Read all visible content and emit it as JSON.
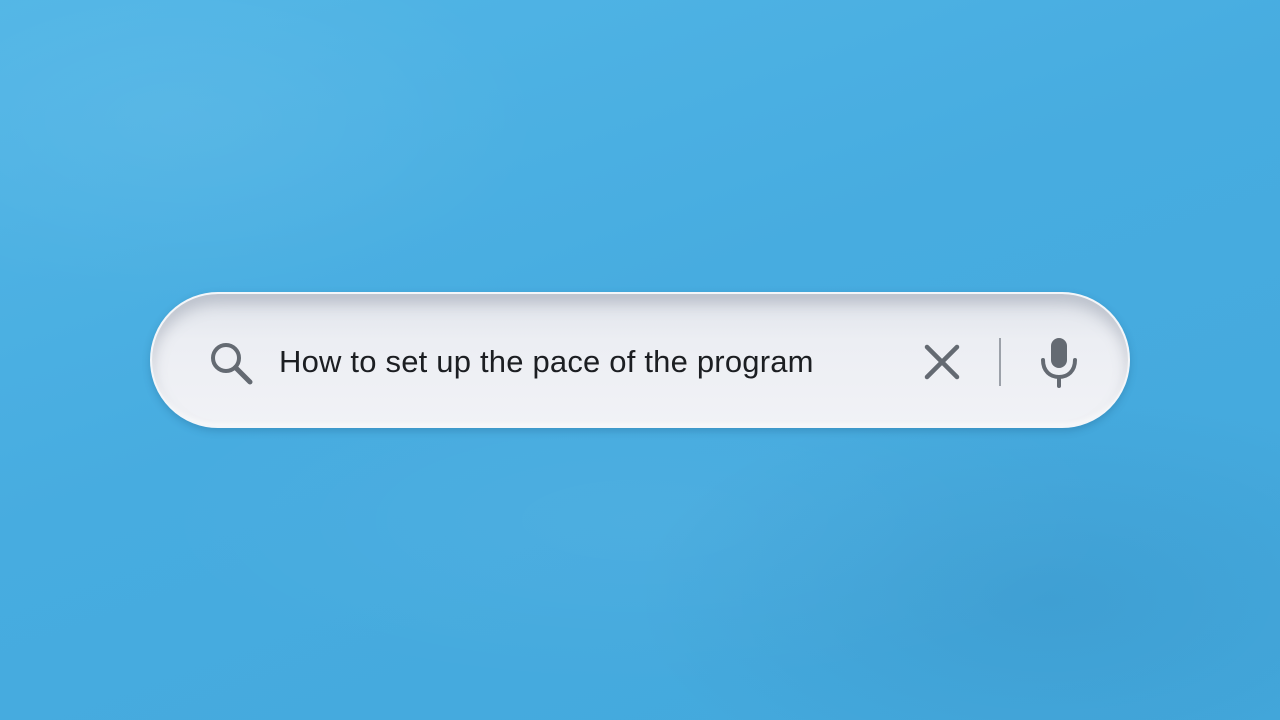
{
  "search": {
    "query": "How to set up the pace of the program",
    "icons": {
      "search": "search-icon",
      "clear": "close-icon",
      "voice": "microphone-icon"
    }
  },
  "colors": {
    "background": "#4aafe0",
    "search_bar": "#eceef3",
    "icon": "#646a72",
    "text": "#1c1e22"
  }
}
